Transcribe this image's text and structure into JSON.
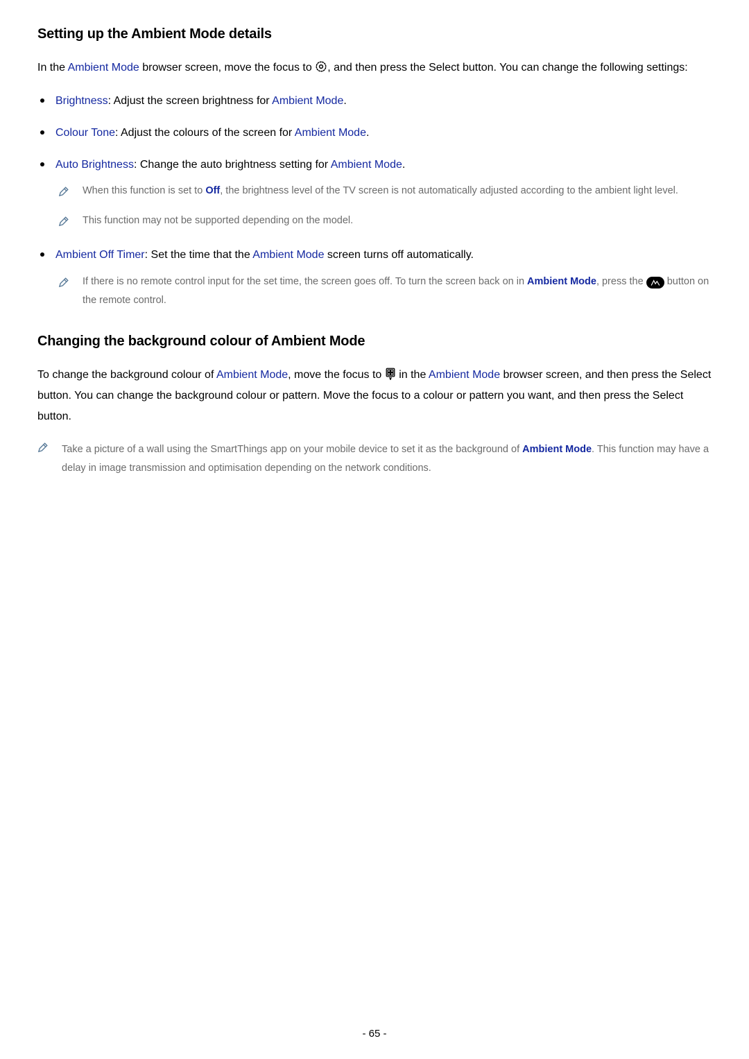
{
  "section1": {
    "heading": "Setting up the Ambient Mode details",
    "intro_before": "In the ",
    "intro_link1": "Ambient Mode",
    "intro_mid": " browser screen, move the focus to ",
    "intro_after": ", and then press the Select button. You can change the following settings:",
    "bullets": {
      "b1_link": "Brightness",
      "b1_text": ": Adjust the screen brightness for ",
      "b1_link2": "Ambient Mode",
      "b1_end": ".",
      "b2_link": "Colour Tone",
      "b2_text": ": Adjust the colours of the screen for ",
      "b2_link2": "Ambient Mode",
      "b2_end": ".",
      "b3_link": "Auto Brightness",
      "b3_text": ": Change the auto brightness setting for ",
      "b3_link2": "Ambient Mode",
      "b3_end": ".",
      "b3_note1_before": "When this function is set to ",
      "b3_note1_off": "Off",
      "b3_note1_after": ", the brightness level of the TV screen is not automatically adjusted according to the ambient light level.",
      "b3_note2": "This function may not be supported depending on the model.",
      "b4_link": "Ambient Off Timer",
      "b4_text": ": Set the time that the ",
      "b4_link2": "Ambient Mode",
      "b4_end": " screen turns off automatically.",
      "b4_note_before": "If there is no remote control input for the set time, the screen goes off. To turn the screen back on in ",
      "b4_note_link": "Ambient Mode",
      "b4_note_mid": ", press the ",
      "b4_note_after": " button on the remote control."
    }
  },
  "section2": {
    "heading": "Changing the background colour of Ambient Mode",
    "p1_before": "To change the background colour of ",
    "p1_link1": "Ambient Mode",
    "p1_mid": ", move the focus to ",
    "p1_mid2": " in the ",
    "p1_link2": "Ambient Mode",
    "p1_after": " browser screen, and then press the Select button. You can change the background colour or pattern. Move the focus to a colour or pattern you want, and then press the Select button.",
    "note_before": "Take a picture of a wall using the SmartThings app on your mobile device to set it as the background of ",
    "note_link": "Ambient Mode",
    "note_after": ". This function may have a delay in image transmission and optimisation depending on the network conditions."
  },
  "page_number": "- 65 -"
}
